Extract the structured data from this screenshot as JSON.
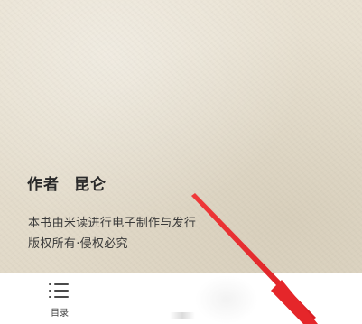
{
  "book_page": {
    "author_label": "作者",
    "author_name": "昆仑",
    "production_note": "本书由米读进行电子制作与发行",
    "copyright_note": "版权所有·侵权必究"
  },
  "bottom_bar": {
    "tabs": [
      {
        "label": "目录",
        "icon": "table-of-contents-icon"
      }
    ]
  },
  "colors": {
    "page_background": "#e6dfcf",
    "text_primary": "#2a2a2a",
    "annotation_arrow": "#e5262a"
  }
}
